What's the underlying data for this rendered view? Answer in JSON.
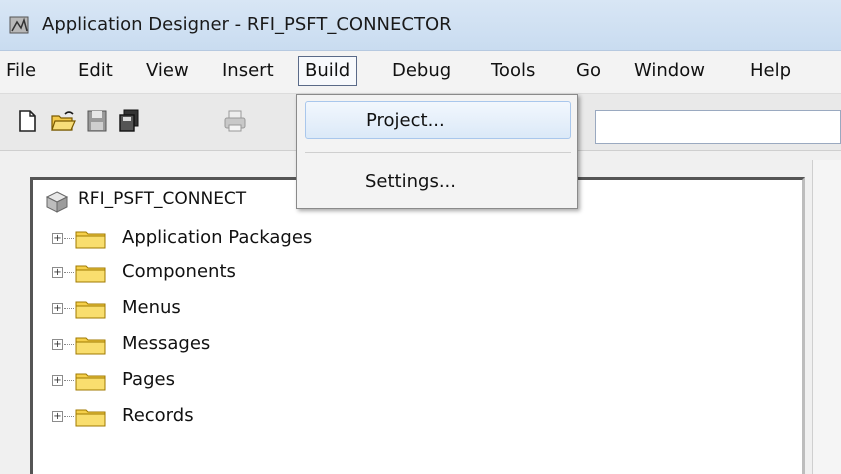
{
  "window": {
    "title": "Application Designer - RFI_PSFT_CONNECTOR",
    "app_icon": "application-designer-icon"
  },
  "menubar": {
    "items": [
      "File",
      "Edit",
      "View",
      "Insert",
      "Build",
      "Debug",
      "Tools",
      "Go",
      "Window",
      "Help"
    ],
    "active": "Build"
  },
  "toolbar": {
    "buttons": [
      "new-icon",
      "open-icon",
      "save-icon",
      "save-all-icon",
      "print-icon"
    ]
  },
  "build_menu": {
    "items": [
      {
        "label": "Project..."
      },
      {
        "label": "Settings..."
      }
    ],
    "hovered": "Project..."
  },
  "tree": {
    "root_label": "RFI_PSFT_CONNECT",
    "nodes": [
      "Application Packages",
      "Components",
      "Menus",
      "Messages",
      "Pages",
      "Records"
    ]
  },
  "colors": {
    "title_bar": "#c9dcf0",
    "folder": "#f5cf4a",
    "hover": "#dbe9f8"
  }
}
